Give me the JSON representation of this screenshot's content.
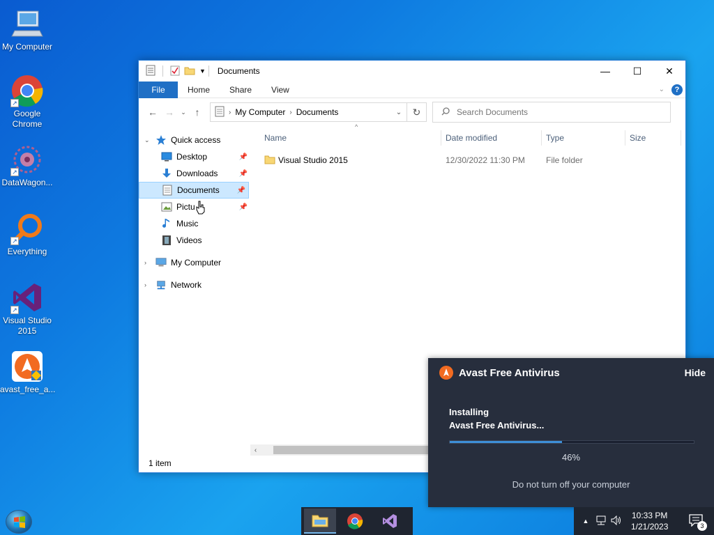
{
  "desktop": {
    "icons": [
      {
        "label": "My Computer"
      },
      {
        "label": "Google Chrome"
      },
      {
        "label": "DataWagon..."
      },
      {
        "label": "Everything"
      },
      {
        "label": "Visual Studio 2015"
      },
      {
        "label": "avast_free_a..."
      }
    ]
  },
  "explorer": {
    "title": "Documents",
    "ribbon": {
      "file": "File",
      "home": "Home",
      "share": "Share",
      "view": "View"
    },
    "address": {
      "crumb1": "My Computer",
      "crumb2": "Documents"
    },
    "search": {
      "placeholder": "Search Documents"
    },
    "nav": {
      "quick_access": "Quick access",
      "desktop": "Desktop",
      "downloads": "Downloads",
      "documents": "Documents",
      "pictures": "Pictu",
      "music": "Music",
      "videos": "Videos",
      "my_computer": "My Computer",
      "network": "Network"
    },
    "columns": {
      "name": "Name",
      "date": "Date modified",
      "type": "Type",
      "size": "Size"
    },
    "files": [
      {
        "name": "Visual Studio 2015",
        "date": "12/30/2022 11:30 PM",
        "type": "File folder",
        "size": ""
      }
    ],
    "status": "1 item"
  },
  "avast": {
    "app_name": "Avast Free Antivirus",
    "hide": "Hide",
    "status_line1": "Installing",
    "status_line2": "Avast Free Antivirus...",
    "progress": 0.46,
    "progress_label": "46%",
    "warning": "Do not turn off your computer"
  },
  "taskbar": {
    "time": "10:33 PM",
    "date": "1/21/2023",
    "notification_count": "3"
  },
  "colors": {
    "accent": "#1f6fc5",
    "avast_bg": "#272e3d",
    "avast_orange": "#f26b21",
    "progress_fill": "#3d8fd8"
  }
}
